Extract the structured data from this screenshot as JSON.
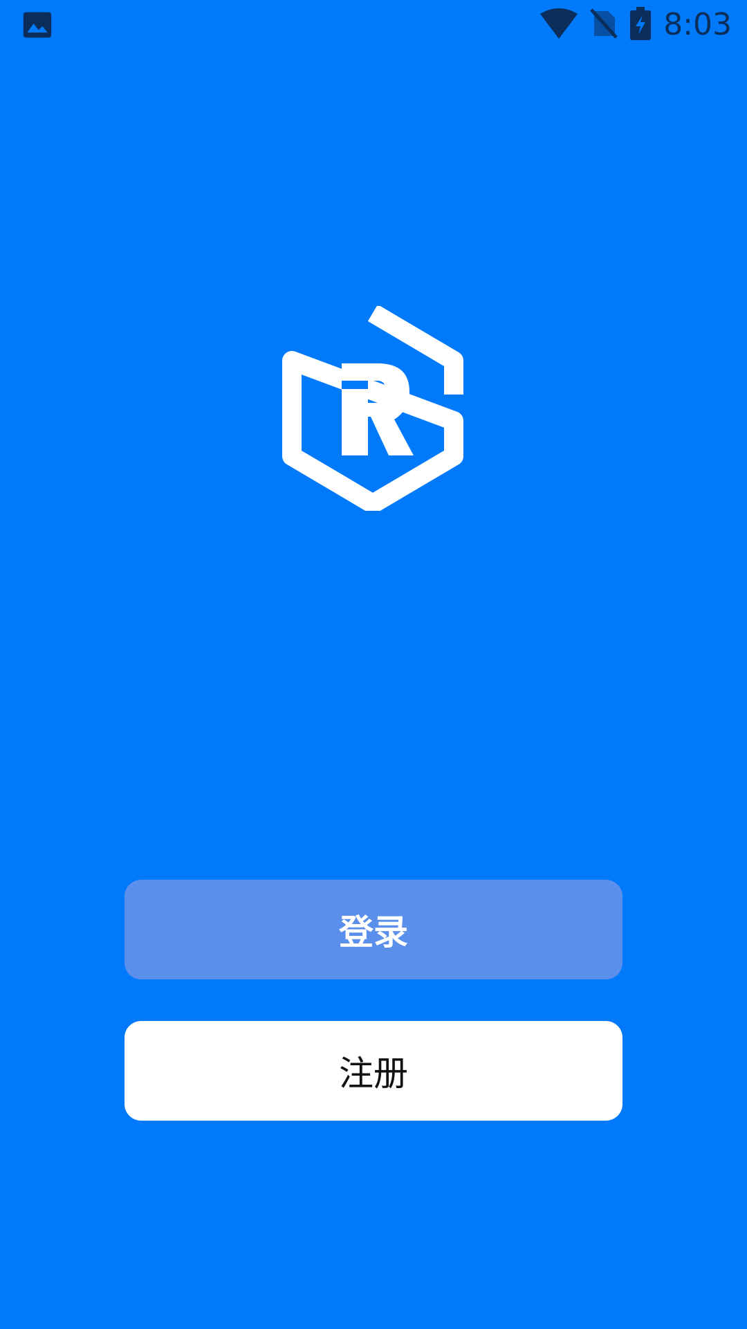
{
  "status_bar": {
    "time": "8:03",
    "icons": [
      "image-icon",
      "wifi-icon",
      "no-sim-icon",
      "battery-charging-icon"
    ]
  },
  "logo": {
    "icon": "rc-hexagon-logo-icon"
  },
  "buttons": {
    "login_label": "登录",
    "register_label": "注册"
  },
  "colors": {
    "background": "#0079FB",
    "login_button": "#5B8FEC",
    "register_button": "#FFFFFF",
    "status_icons": "#0B2D59"
  }
}
